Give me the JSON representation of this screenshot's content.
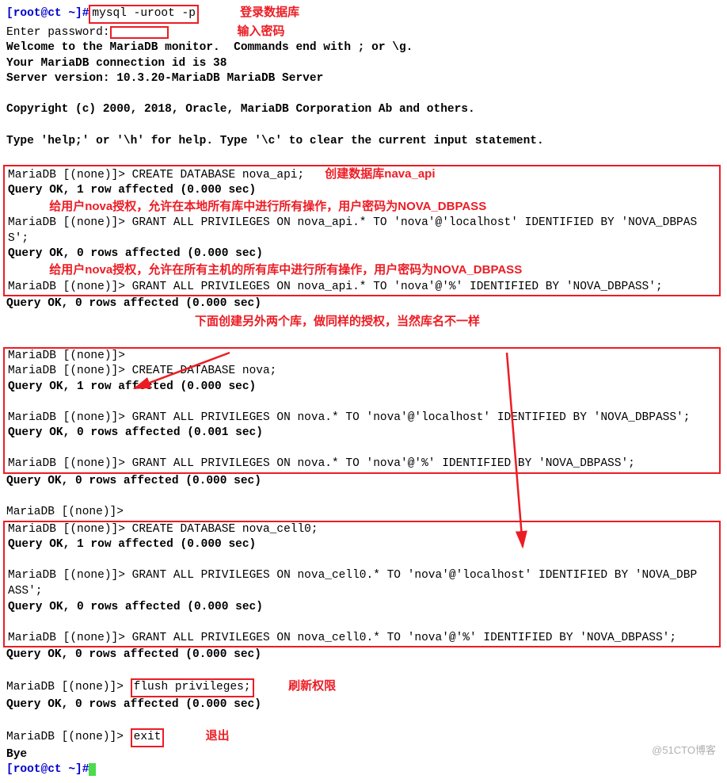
{
  "prompt": "[root@ct ~]#",
  "cmd1": "mysql -uroot -p",
  "ann_login": "登录数据库",
  "enter_pw": "Enter password:",
  "ann_pw": "输入密码",
  "intro1": "Welcome to the MariaDB monitor.  Commands end with ; or \\g.",
  "intro2": "Your MariaDB connection id is 38",
  "intro3": "Server version: 10.3.20-MariaDB MariaDB Server",
  "copyright": "Copyright (c) 2000, 2018, Oracle, MariaDB Corporation Ab and others.",
  "help": "Type 'help;' or '\\h' for help. Type '\\c' to clear the current input statement.",
  "mprompt": "MariaDB [(none)]>",
  "box1": {
    "create_api": "CREATE DATABASE nova_api;",
    "ann_create_api": "创建数据库nava_api",
    "ok1": "Query OK, 1 row affected (0.000 sec)",
    "ann_grant_local": "给用户nova授权，允许在本地所有库中进行所有操作，用户密码为NOVA_DBPASS",
    "grant_local1": "GRANT ALL PRIVILEGES ON nova_api.* TO 'nova'@'localhost' IDENTIFIED BY 'NOVA_DBPAS",
    "grant_local2": "S';",
    "ok0a": "Query OK, 0 rows affected (0.000 sec)",
    "ann_grant_all": "给用户nova授权，允许在所有主机的所有库中进行所有操作，用户密码为NOVA_DBPASS",
    "grant_all": "GRANT ALL PRIVILEGES ON nova_api.* TO 'nova'@'%' IDENTIFIED BY 'NOVA_DBPASS';"
  },
  "ok0b": "Query OK, 0 rows affected (0.000 sec)",
  "center_note": "下面创建另外两个库，做同样的授权，当然库名不一样",
  "box2": {
    "empty": "",
    "create_nova": "CREATE DATABASE nova;",
    "ok_nova": "Query OK, 1 row affected (0.000 sec)",
    "grant_local": "GRANT ALL PRIVILEGES ON nova.* TO 'nova'@'localhost' IDENTIFIED BY 'NOVA_DBPASS';",
    "ok_local": "Query OK, 0 rows affected (0.001 sec)",
    "grant_all": "GRANT ALL PRIVILEGES ON nova.* TO 'nova'@'%' IDENTIFIED BY 'NOVA_DBPASS';"
  },
  "ok0c": "Query OK, 0 rows affected (0.000 sec)",
  "box3": {
    "create_cell": "CREATE DATABASE nova_cell0;",
    "ok_cell": "Query OK, 1 row affected (0.000 sec)",
    "grant_local1": "GRANT ALL PRIVILEGES ON nova_cell0.* TO 'nova'@'localhost' IDENTIFIED BY 'NOVA_DBP",
    "grant_local2": "ASS';",
    "ok_local": "Query OK, 0 rows affected (0.000 sec)",
    "grant_all": "GRANT ALL PRIVILEGES ON nova_cell0.* TO 'nova'@'%' IDENTIFIED BY 'NOVA_DBPASS';"
  },
  "ok0d": "Query OK, 0 rows affected (0.000 sec)",
  "flush_cmd": "flush privileges;",
  "ann_flush": "刷新权限",
  "ok_flush": "Query OK, 0 rows affected (0.000 sec)",
  "exit_cmd": "exit",
  "ann_exit": "退出",
  "bye": "Bye",
  "watermark": "@51CTO博客"
}
